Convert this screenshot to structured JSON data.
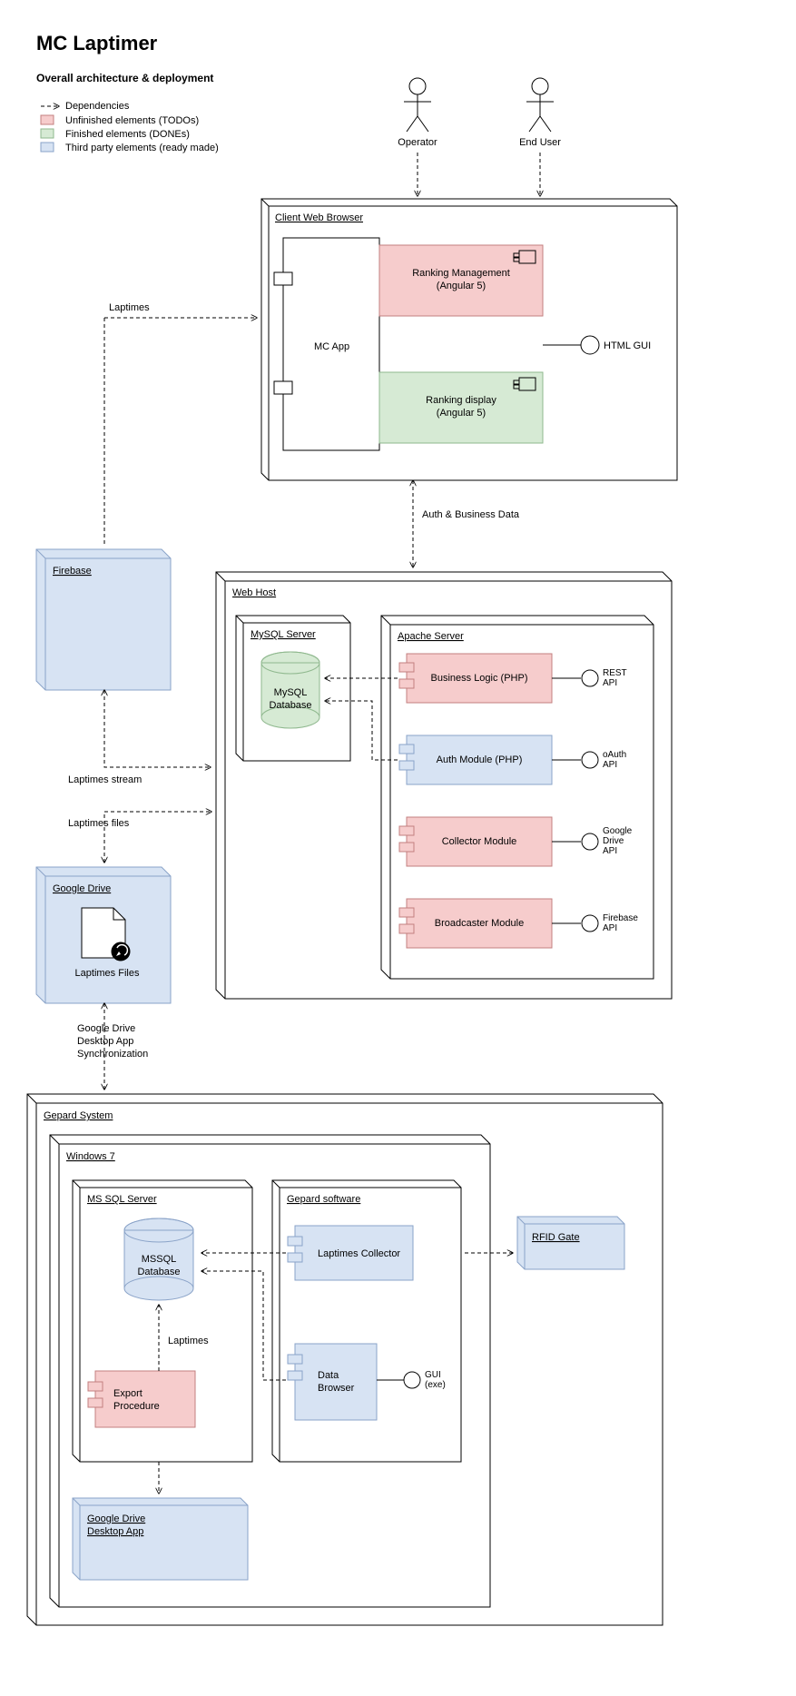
{
  "header": {
    "title": "MC Laptimer",
    "subtitle": "Overall architecture & deployment"
  },
  "legend": {
    "dependencies": "Dependencies",
    "todo": "Unfinished elements (TODOs)",
    "done": "Finished elements (DONEs)",
    "third": "Third party elements (ready made)"
  },
  "actors": {
    "operator": "Operator",
    "enduser": "End User"
  },
  "client": {
    "title": "Client Web Browser",
    "mcapp": "MC App",
    "rankMgmt": "Ranking Management\n(Angular 5)",
    "rankDisp": "Ranking display\n(Angular 5)",
    "htmlgui": "HTML GUI"
  },
  "labels": {
    "laptimes": "Laptimes",
    "authBiz": "Auth & Business Data",
    "laptimesStream": "Laptimes stream",
    "laptimesFiles": "Laptimes files",
    "gdSync": "Google Drive\nDesktop App\nSynchronization",
    "laptimesArrow": "Laptimes"
  },
  "firebase": {
    "title": "Firebase"
  },
  "webhost": {
    "title": "Web Host",
    "mysqlServer": "MySQL Server",
    "mysqlDb": "MySQL\nDatabase",
    "apacheServer": "Apache Server",
    "bizLogic": "Business Logic (PHP)",
    "authModule": "Auth Module (PHP)",
    "collector": "Collector Module",
    "broadcaster": "Broadcaster Module",
    "restApi": "REST\nAPI",
    "oauthApi": "oAuth\nAPI",
    "gdriveApi": "Google\nDrive\nAPI",
    "firebaseApi": "Firebase\nAPI"
  },
  "gdrive": {
    "title": "Google Drive",
    "filesLabel": "Laptimes Files"
  },
  "gepard": {
    "title": "Gepard System",
    "win7": "Windows 7",
    "mssqlServer": "MS SQL Server",
    "mssqlDb": "MSSQL\nDatabase",
    "exportProc": "Export\nProcedure",
    "gepardSw": "Gepard software",
    "laptimesCollector": "Laptimes Collector",
    "dataBrowser": "Data\nBrowser",
    "gui": "GUI\n(exe)",
    "rfid": "RFID Gate",
    "gdApp": "Google Drive\nDesktop App"
  }
}
